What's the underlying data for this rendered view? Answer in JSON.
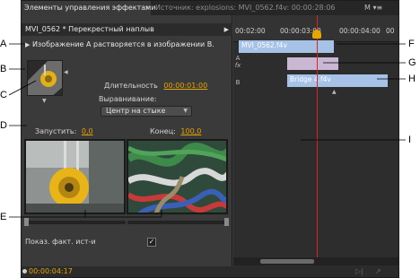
{
  "tabs": {
    "active": "Элементы управления эффектами",
    "close": "×",
    "source": "Источник: explosions: MVI_0562.f4v: 00:00:28:06",
    "menu": "M ▾≡"
  },
  "effect": {
    "header": "MVI_0562 * Перекрестный наплыв",
    "play_icon": "play-icon",
    "description": "Изображение A растворяется в изображении B.",
    "duration_label": "Длительность",
    "duration_value": "00:00:01:00",
    "alignment_label": "Выравнивание:",
    "alignment_value": "Центр на стыке",
    "start_label": "Запустить:",
    "start_value": "0,0",
    "end_label": "Конец:",
    "end_value": "100,0",
    "show_actual_label": "Показ. факт. ист-и",
    "show_actual_checked": true
  },
  "timeline": {
    "times": [
      "00:02:00",
      "00:00:03:00",
      "00:00:04:00",
      "00"
    ],
    "track_labels": [
      "A",
      "fx",
      "B"
    ],
    "clip_a": "MVI_0562.f4v",
    "clip_b": "Bridge 4.f4v"
  },
  "footer": {
    "time": "00:00:04:17"
  },
  "callouts": [
    "A",
    "B",
    "C",
    "D",
    "E",
    "F",
    "G",
    "H",
    "I"
  ],
  "colors": {
    "accent": "#e8a400",
    "playhead": "#e0221f",
    "clip": "#a6c2e6",
    "transition": "#c9b7d4"
  }
}
